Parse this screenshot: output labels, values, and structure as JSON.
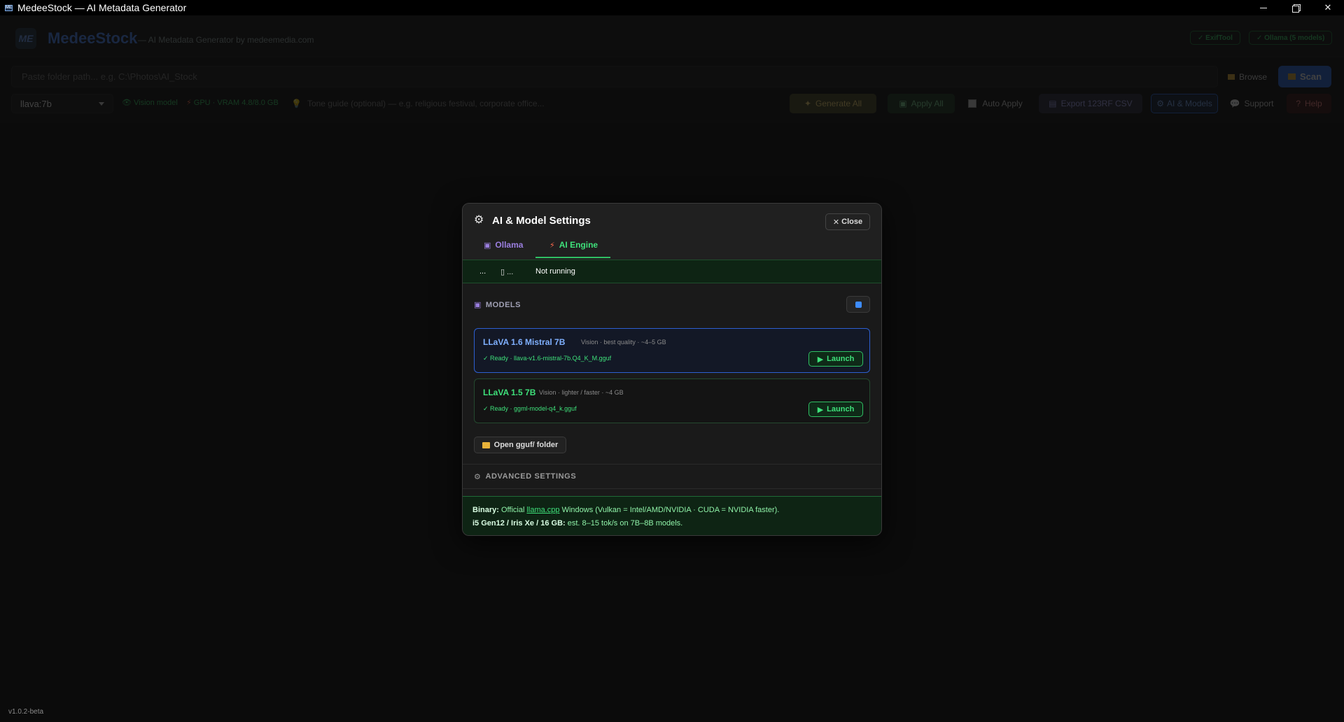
{
  "window": {
    "title": "MedeeStock — AI Metadata Generator",
    "icon_text": "ME"
  },
  "header": {
    "logo_text": "ME",
    "brand": "MedeeStock",
    "tagline": "— AI Metadata Generator by medeemedia.com",
    "badges": [
      {
        "label": "✓ ExifTool"
      },
      {
        "label": "✓ Ollama (5 models)"
      }
    ]
  },
  "toolbar": {
    "path_placeholder": "Paste folder path... e.g. C:\\Photos\\AI_Stock",
    "browse_label": "Browse",
    "scan_label": "Scan",
    "model_selected": "llava:7b",
    "vision_label": "Vision model",
    "gpu_label": "GPU · VRAM 4.8/8.0 GB",
    "tone_placeholder": "Tone guide (optional) — e.g. religious festival, corporate office...",
    "generate_all_label": "Generate All",
    "apply_all_label": "Apply All",
    "auto_apply_label": "Auto Apply",
    "export_label": "Export 123RF CSV",
    "ai_models_label": "AI & Models",
    "support_label": "Support",
    "help_label": "Help"
  },
  "modal": {
    "title": "AI & Model Settings",
    "close_label": "Close",
    "tabs": [
      {
        "label": "Ollama",
        "icon": "robot-icon"
      },
      {
        "label": "AI Engine",
        "icon": "lightning-icon",
        "active": true
      }
    ],
    "status": {
      "dots": "...",
      "device": "...",
      "state": "Not running"
    },
    "models_heading": "MODELS",
    "models": [
      {
        "name": "LLaVA 1.6 Mistral 7B",
        "meta": "Vision · best quality · ~4–5 GB",
        "status": "✓ Ready · llava-v1.6-mistral-7b.Q4_K_M.gguf",
        "launch_label": "Launch"
      },
      {
        "name": "LLaVA 1.5 7B",
        "meta": "Vision · lighter / faster · ~4 GB",
        "status": "✓ Ready · ggml-model-q4_k.gguf",
        "launch_label": "Launch"
      }
    ],
    "open_folder_label": "Open gguf/ folder",
    "advanced_label": "ADVANCED SETTINGS",
    "info": {
      "binary_label": "Binary:",
      "binary_pre": "Official",
      "binary_link": "llama.cpp",
      "binary_post": "Windows (Vulkan = Intel/AMD/NVIDIA · CUDA = NVIDIA faster).",
      "hw_label": "i5 Gen12 / Iris Xe / 16 GB:",
      "hw_text": "est. 8–15 tok/s on 7B–8B models."
    }
  },
  "footer": {
    "version": "v1.0.2-beta"
  }
}
